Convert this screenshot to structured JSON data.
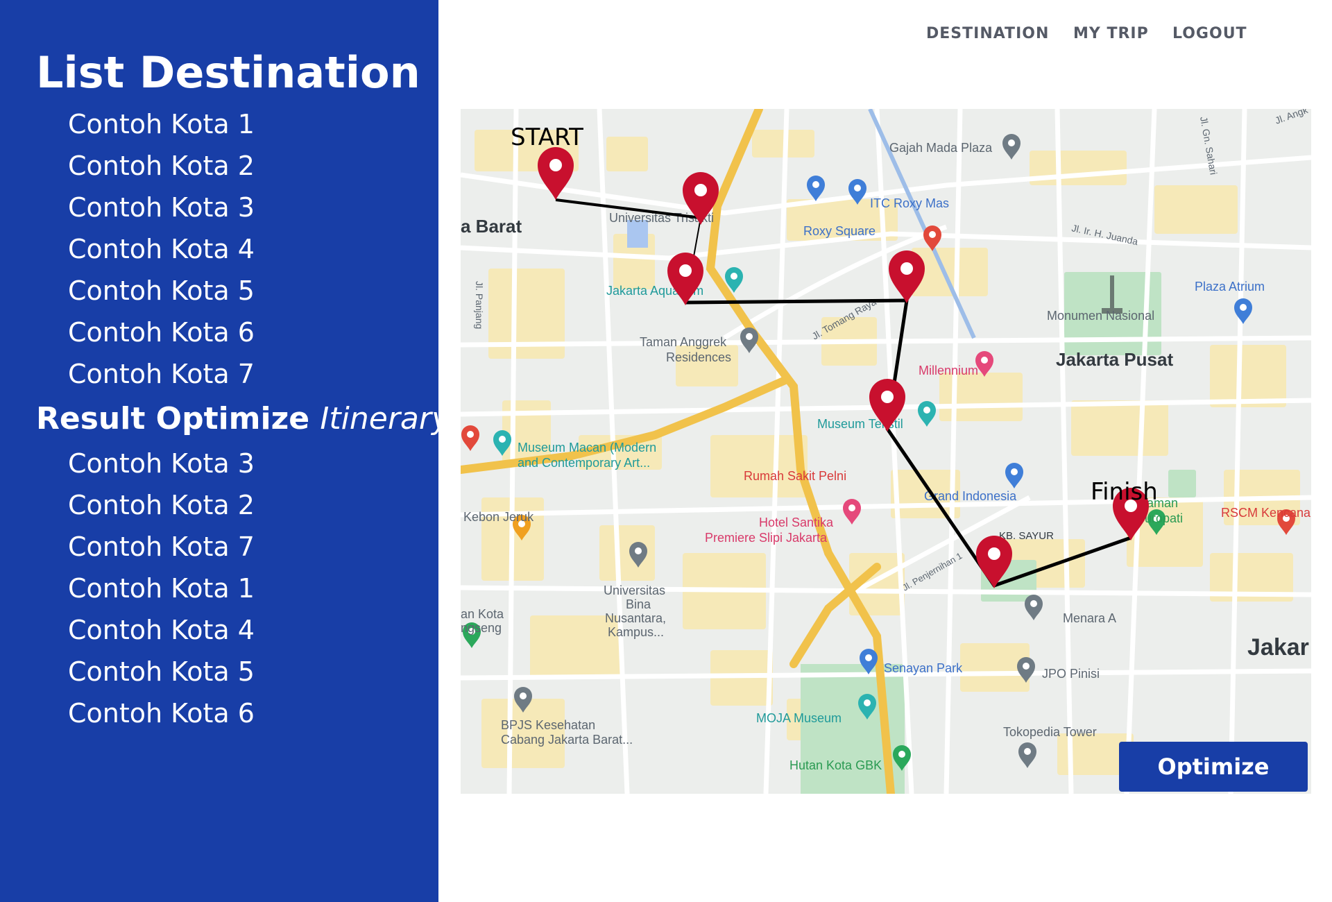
{
  "sidebar": {
    "list_title": "List Destination",
    "destinations": [
      "Contoh Kota 1",
      "Contoh Kota 2",
      "Contoh Kota 3",
      "Contoh Kota 4",
      "Contoh Kota 5",
      "Contoh Kota 6",
      "Contoh Kota 7"
    ],
    "result_title": "Result Optimize",
    "result_title_italic": "Itinerary",
    "results": [
      "Contoh Kota 3",
      "Contoh Kota 2",
      "Contoh Kota 7",
      "Contoh Kota 1",
      "Contoh Kota 4",
      "Contoh Kota 5",
      "Contoh Kota 6"
    ]
  },
  "nav": {
    "destination": "DESTINATION",
    "my_trip": "MY TRIP",
    "logout": "LOGOUT"
  },
  "map": {
    "start_label": "START",
    "finish_label": "Finish",
    "places": {
      "gajah_mada": "Gajah Mada Plaza",
      "itc_roxy": "ITC Roxy Mas",
      "roxy_square": "Roxy Square",
      "univ_trisakti": "Universitas Trisakti",
      "jakarta_aquarium": "Jakarta Aquarium",
      "taman_anggrek": "Taman Anggrek",
      "residences": "Residences",
      "monumen": "Monumen Nasional",
      "jakarta_pusat": "Jakarta Pusat",
      "millennium": "Millennium",
      "plaza_atrium": "Plaza Atrium",
      "museum_tekstil": "Museum Tekstil",
      "museum_macan_1": "Museum Macan (Modern",
      "museum_macan_2": "and Contemporary Art...",
      "rumah_sakit": "Rumah Sakit Pelni",
      "grand_indonesia": "Grand Indonesia",
      "hotel_santika_1": "Hotel Santika",
      "hotel_santika_2": "Premiere Slipi Jakarta",
      "kebon_jeruk": "Kebon Jeruk",
      "kb_sayur": "KB. SAYUR",
      "taman_suropati_1": "Taman",
      "taman_suropati_2": "Suropati",
      "rscm": "RSCM Kencana",
      "univ_bina_1": "Universitas",
      "univ_bina_2": "Bina",
      "univ_bina_3": "Nusantara,",
      "univ_bina_4": "Kampus...",
      "menara": "Menara A",
      "jakarta_right": "Jakar",
      "senayan": "Senayan Park",
      "jpo": "JPO Pinisi",
      "moja": "MOJA Museum",
      "tokopedia": "Tokopedia Tower",
      "hutan_kota": "Hutan Kota GBK",
      "bpjs_1": "BPJS Kesehatan",
      "bpjs_2": "Cabang Jakarta Barat...",
      "barat": "a Barat",
      "hutan_left_1": "an Kota",
      "hutan_left_2": "ngseng",
      "jl_tomang": "Jl. Tomang Raya",
      "jl_juanda": "Jl. Ir. H. Juanda",
      "jl_panjang": "Jl. Panjang",
      "jl_pejernihan": "Jl. Penjernihan 1",
      "jl_gn_sahari": "Jl. Gn. Sahari",
      "jl_angk": "Jl. Angk"
    }
  },
  "optimize_label": "Optimize",
  "colors": {
    "sidebar_bg": "#183ea7",
    "pin": "#c8102e",
    "button_bg": "#183ea7",
    "route": "#000000"
  },
  "icons": [
    "map-pin-icon",
    "poi-marker-icon"
  ]
}
